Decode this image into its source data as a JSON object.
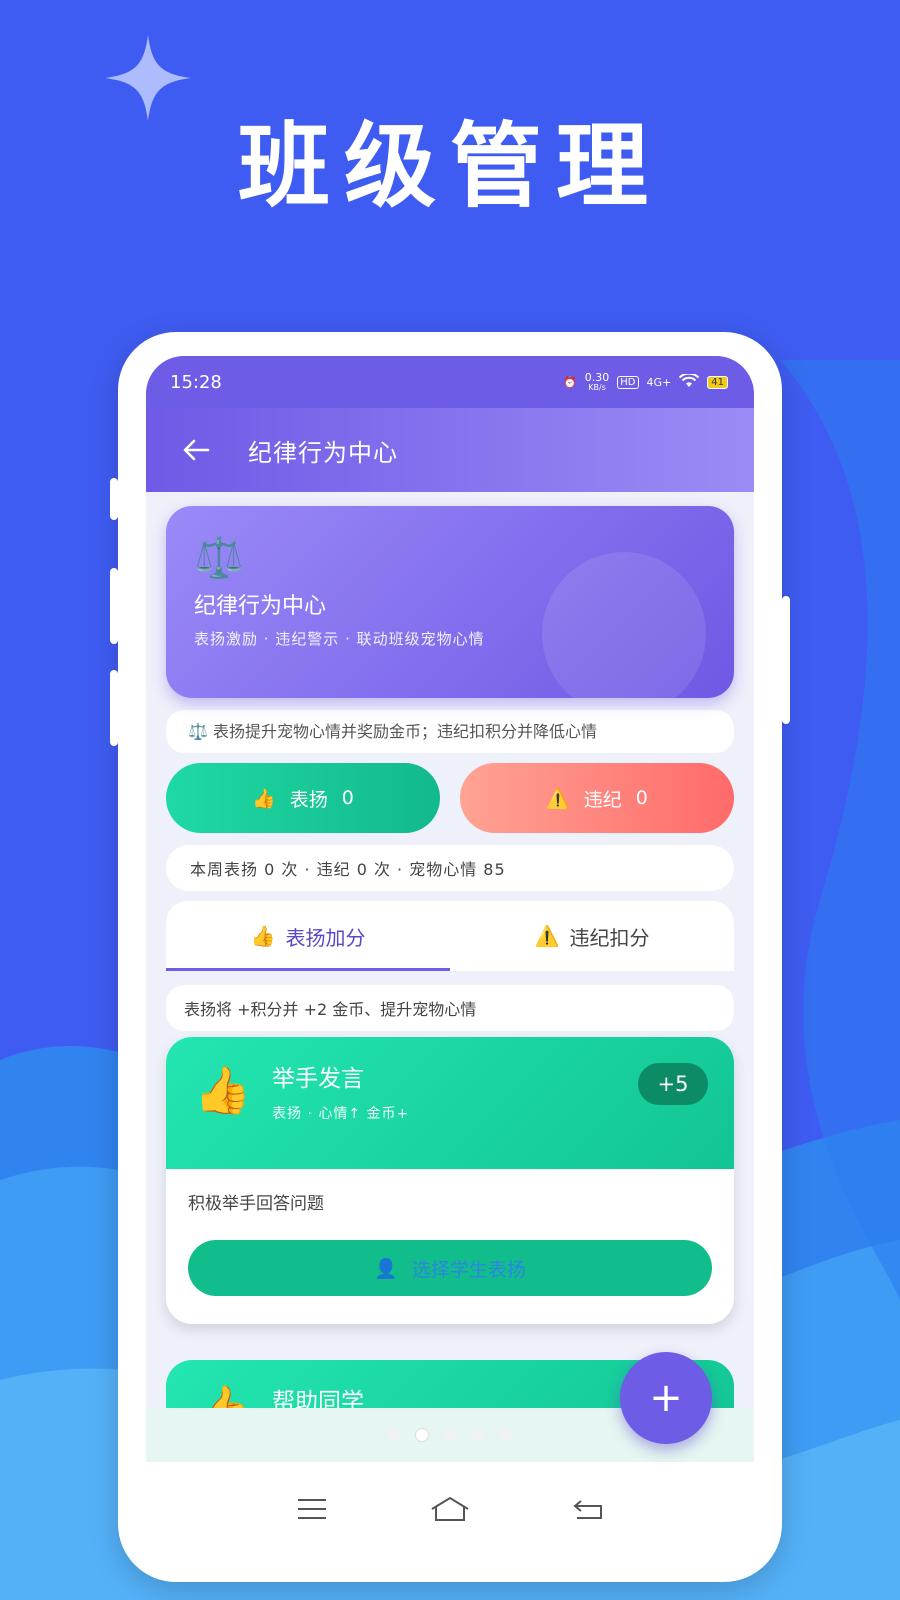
{
  "hero_title": "班级管理",
  "status_bar": {
    "time": "15:28",
    "net_speed_value": "0.30",
    "net_speed_unit": "KB/s",
    "hd": "HD",
    "signal": "4G+",
    "battery": "41"
  },
  "app_bar": {
    "title": "纪律行为中心"
  },
  "hero_card": {
    "icon": "scale-icon",
    "title": "纪律行为中心",
    "subtitle": "表扬激励 · 违纪警示 · 联动班级宠物心情"
  },
  "info_text": "表扬提升宠物心情并奖励金币；违纪扣积分并降低心情",
  "buttons": {
    "praise_label": "表扬",
    "praise_count": "0",
    "violate_label": "违纪",
    "violate_count": "0"
  },
  "weekly_summary": "本周表扬 0 次 · 违纪 0 次 · 宠物心情 85",
  "tabs": [
    {
      "label": "表扬加分",
      "icon": "thumbs-up-icon",
      "active": true
    },
    {
      "label": "违纪扣分",
      "icon": "warning-icon",
      "active": false
    }
  ],
  "hint": "表扬将 +积分并 +2 金币、提升宠物心情",
  "actions": [
    {
      "name": "举手发言",
      "meta": "表扬 · 心情↑ 金币+",
      "points": "+5",
      "description": "积极举手回答问题",
      "button_label": "选择学生表扬"
    },
    {
      "name": "帮助同学"
    }
  ],
  "fab_label": "+",
  "colors": {
    "accent": "#6d5ce6",
    "praise": "#13b98a",
    "violate": "#ff6a6a",
    "background": "#3f5cf2"
  }
}
